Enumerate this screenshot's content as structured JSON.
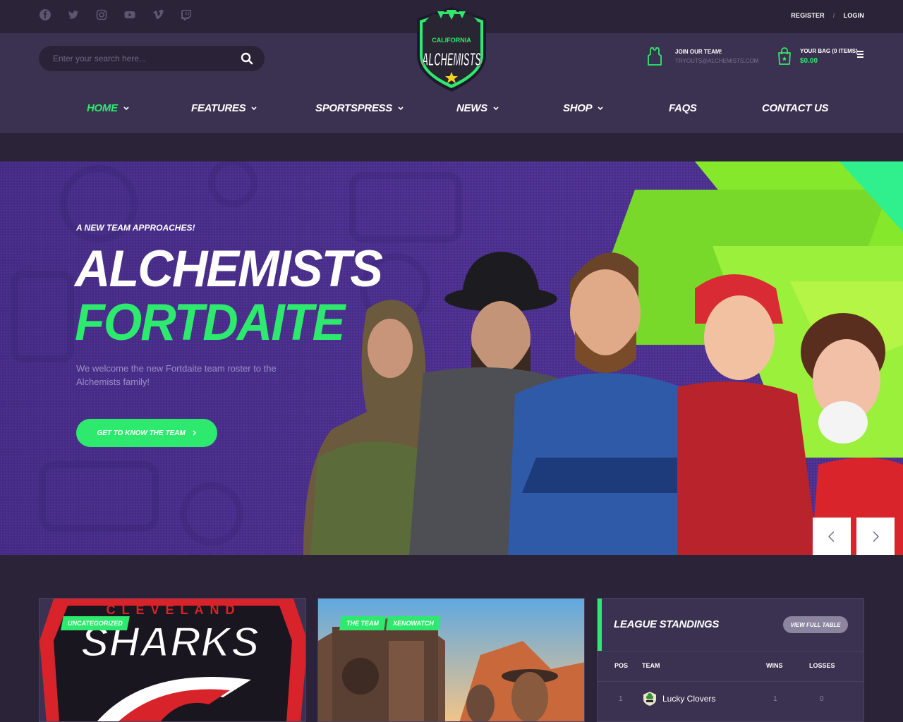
{
  "topbar": {
    "socials": [
      "facebook-icon",
      "twitter-icon",
      "instagram-icon",
      "youtube-icon",
      "vimeo-icon",
      "twitch-icon"
    ],
    "register": "REGISTER",
    "separator": "/",
    "login": "LOGIN"
  },
  "header": {
    "search_placeholder": "Enter your search here...",
    "join_title": "JOIN OUR TEAM!",
    "join_email": "TRYOUTS@ALCHEMISTS.COM",
    "bag_title": "YOUR BAG (0 ITEMS)",
    "bag_total": "$0.00"
  },
  "logo": {
    "top": "CALIFORNIA",
    "name": "ALCHEMISTS"
  },
  "nav": {
    "items": [
      {
        "label": "HOME"
      },
      {
        "label": "FEATURES"
      },
      {
        "label": "SPORTSPRESS"
      },
      {
        "label": "NEWS"
      },
      {
        "label": "SHOP"
      },
      {
        "label": "FAQS"
      },
      {
        "label": "CONTACT US"
      }
    ]
  },
  "hero": {
    "kicker": "A NEW TEAM APPROACHES!",
    "title_line1": "ALCHEMISTS",
    "title_line2": "FORTDAITE",
    "description": "We welcome the new Fortdaite team roster to the Alchemists family!",
    "button": "GET TO KNOW THE TEAM"
  },
  "cards": [
    {
      "tags": [
        "UNCATEGORIZED"
      ],
      "image_text_top": "CLEVELAND",
      "image_text_main": "SHARKS"
    },
    {
      "tags": [
        "THE TEAM",
        "XENOWATCH"
      ]
    }
  ],
  "standings": {
    "title": "LEAGUE STANDINGS",
    "view_button": "VIEW FULL TABLE",
    "columns": [
      "POS",
      "TEAM",
      "WINS",
      "LOSSES"
    ],
    "rows": [
      {
        "pos": "1",
        "team": "Lucky Clovers",
        "wins": "1",
        "losses": "0"
      }
    ]
  },
  "colors": {
    "accent": "#2dea6e",
    "bg_dark": "#2b2438",
    "bg_panel": "#3b3150",
    "hero_purple": "#4a2f8a",
    "hero_lime": "#8df02a"
  }
}
